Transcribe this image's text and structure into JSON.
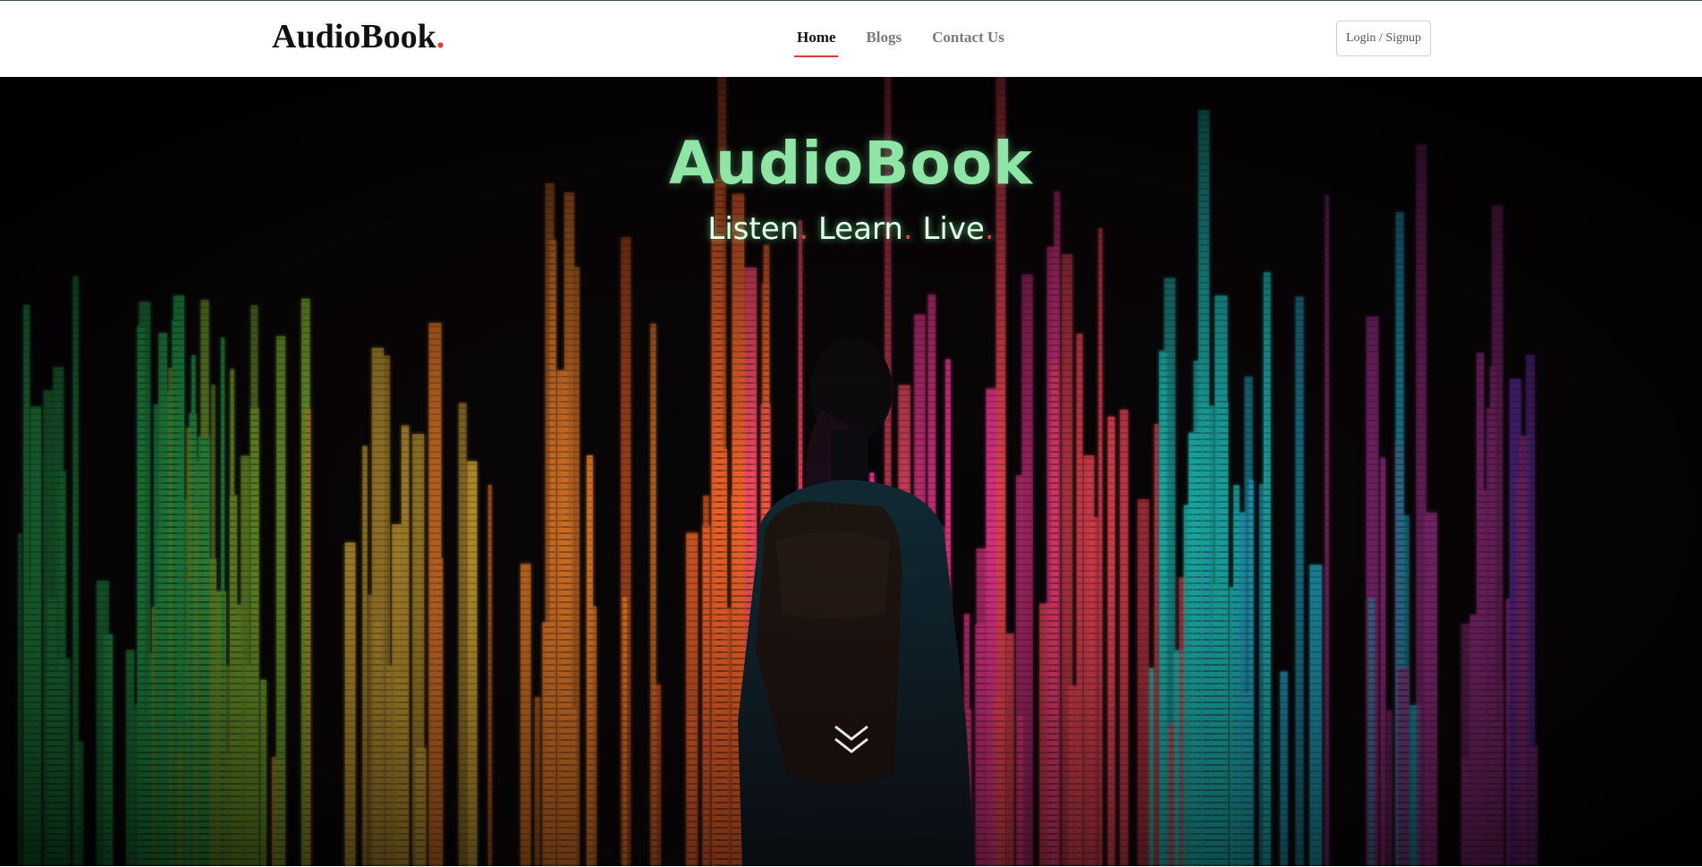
{
  "navbar": {
    "brand": "AudioBook",
    "brand_dot": ".",
    "links": [
      {
        "label": "Home",
        "active": true
      },
      {
        "label": "Blogs",
        "active": false
      },
      {
        "label": "Contact Us",
        "active": false
      }
    ],
    "login_label": "Login / Signup"
  },
  "hero": {
    "title": "AudioBook",
    "tagline": [
      "Listen",
      "Learn",
      "Live"
    ],
    "separator": ".",
    "scroll_icon": "double-chevron-down-icon"
  },
  "colors": {
    "accent": "#e53935",
    "title_green": "#8fe5a6",
    "hero_background": "#050505"
  }
}
